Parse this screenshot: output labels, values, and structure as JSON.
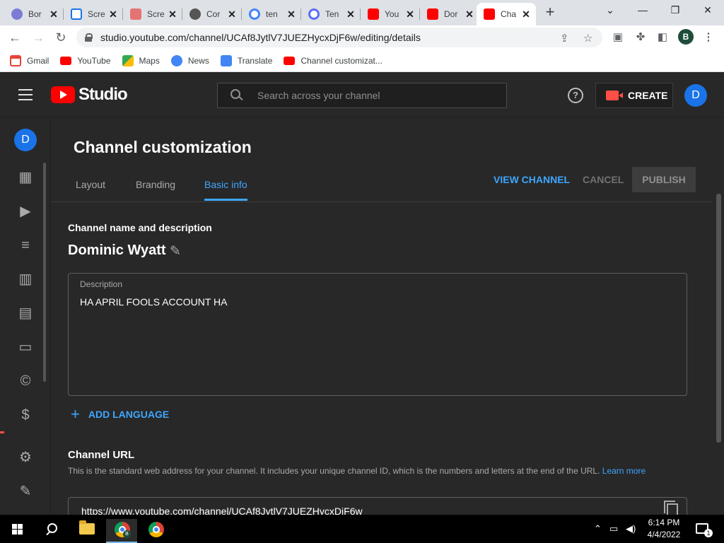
{
  "browser": {
    "tabs": [
      {
        "title": "Bor",
        "icon": "tab-favicon-icon",
        "color": "#7b7bd6"
      },
      {
        "title": "Scre",
        "icon": "screencast-icon",
        "color": "#1a73e8"
      },
      {
        "title": "Scre",
        "icon": "screenshot-icon",
        "color": "#e57373"
      },
      {
        "title": "Cor",
        "icon": "app-icon",
        "color": "#555555"
      },
      {
        "title": "ten",
        "icon": "google-icon",
        "color": "#4285f4"
      },
      {
        "title": "Ten",
        "icon": "at-icon",
        "color": "#5b6ef5"
      },
      {
        "title": "You",
        "icon": "youtube-icon",
        "color": "#ff0000"
      },
      {
        "title": "Dor",
        "icon": "youtube-icon",
        "color": "#ff0000"
      },
      {
        "title": "Cha",
        "icon": "youtube-icon",
        "color": "#ff0000"
      }
    ],
    "url": "studio.youtube.com/channel/UCAf8JytlV7JUEZHycxDjF6w/editing/details",
    "profile_initial": "B",
    "bookmarks": [
      {
        "label": "Gmail",
        "icon": "gmail-icon",
        "color": "#ea4335"
      },
      {
        "label": "YouTube",
        "icon": "youtube-icon",
        "color": "#ff0000"
      },
      {
        "label": "Maps",
        "icon": "maps-icon",
        "color": "#34a853"
      },
      {
        "label": "News",
        "icon": "news-icon",
        "color": "#4285f4"
      },
      {
        "label": "Translate",
        "icon": "translate-icon",
        "color": "#4285f4"
      },
      {
        "label": "Channel customizat...",
        "icon": "youtube-icon",
        "color": "#ff0000"
      }
    ]
  },
  "studio": {
    "logo_text": "Studio",
    "search_placeholder": "Search across your channel",
    "create_label": "CREATE",
    "avatar_initial": "D",
    "page_title": "Channel customization",
    "tabs": [
      "Layout",
      "Branding",
      "Basic info"
    ],
    "active_tab": "Basic info",
    "view_channel": "VIEW CHANNEL",
    "cancel": "CANCEL",
    "publish": "PUBLISH",
    "name_section_title": "Channel name and description",
    "channel_name": "Dominic Wyatt",
    "description_label": "Description",
    "description_value": "HA APRIL FOOLS ACCOUNT HA",
    "add_language": "ADD LANGUAGE",
    "url_section_title": "Channel URL",
    "url_help": "This is the standard web address for your channel. It includes your unique channel ID, which is the numbers and letters at the end of the URL.",
    "url_help_link": "Learn more",
    "channel_url": "https://www.youtube.com/channel/UCAf8JytlV7JUEZHycxDjF6w"
  },
  "taskbar": {
    "time": "6:14 PM",
    "date": "4/4/2022",
    "notification_count": "1"
  },
  "colors": {
    "accent": "#3ea6ff",
    "brand_red": "#ff0000",
    "background": "#282828"
  }
}
